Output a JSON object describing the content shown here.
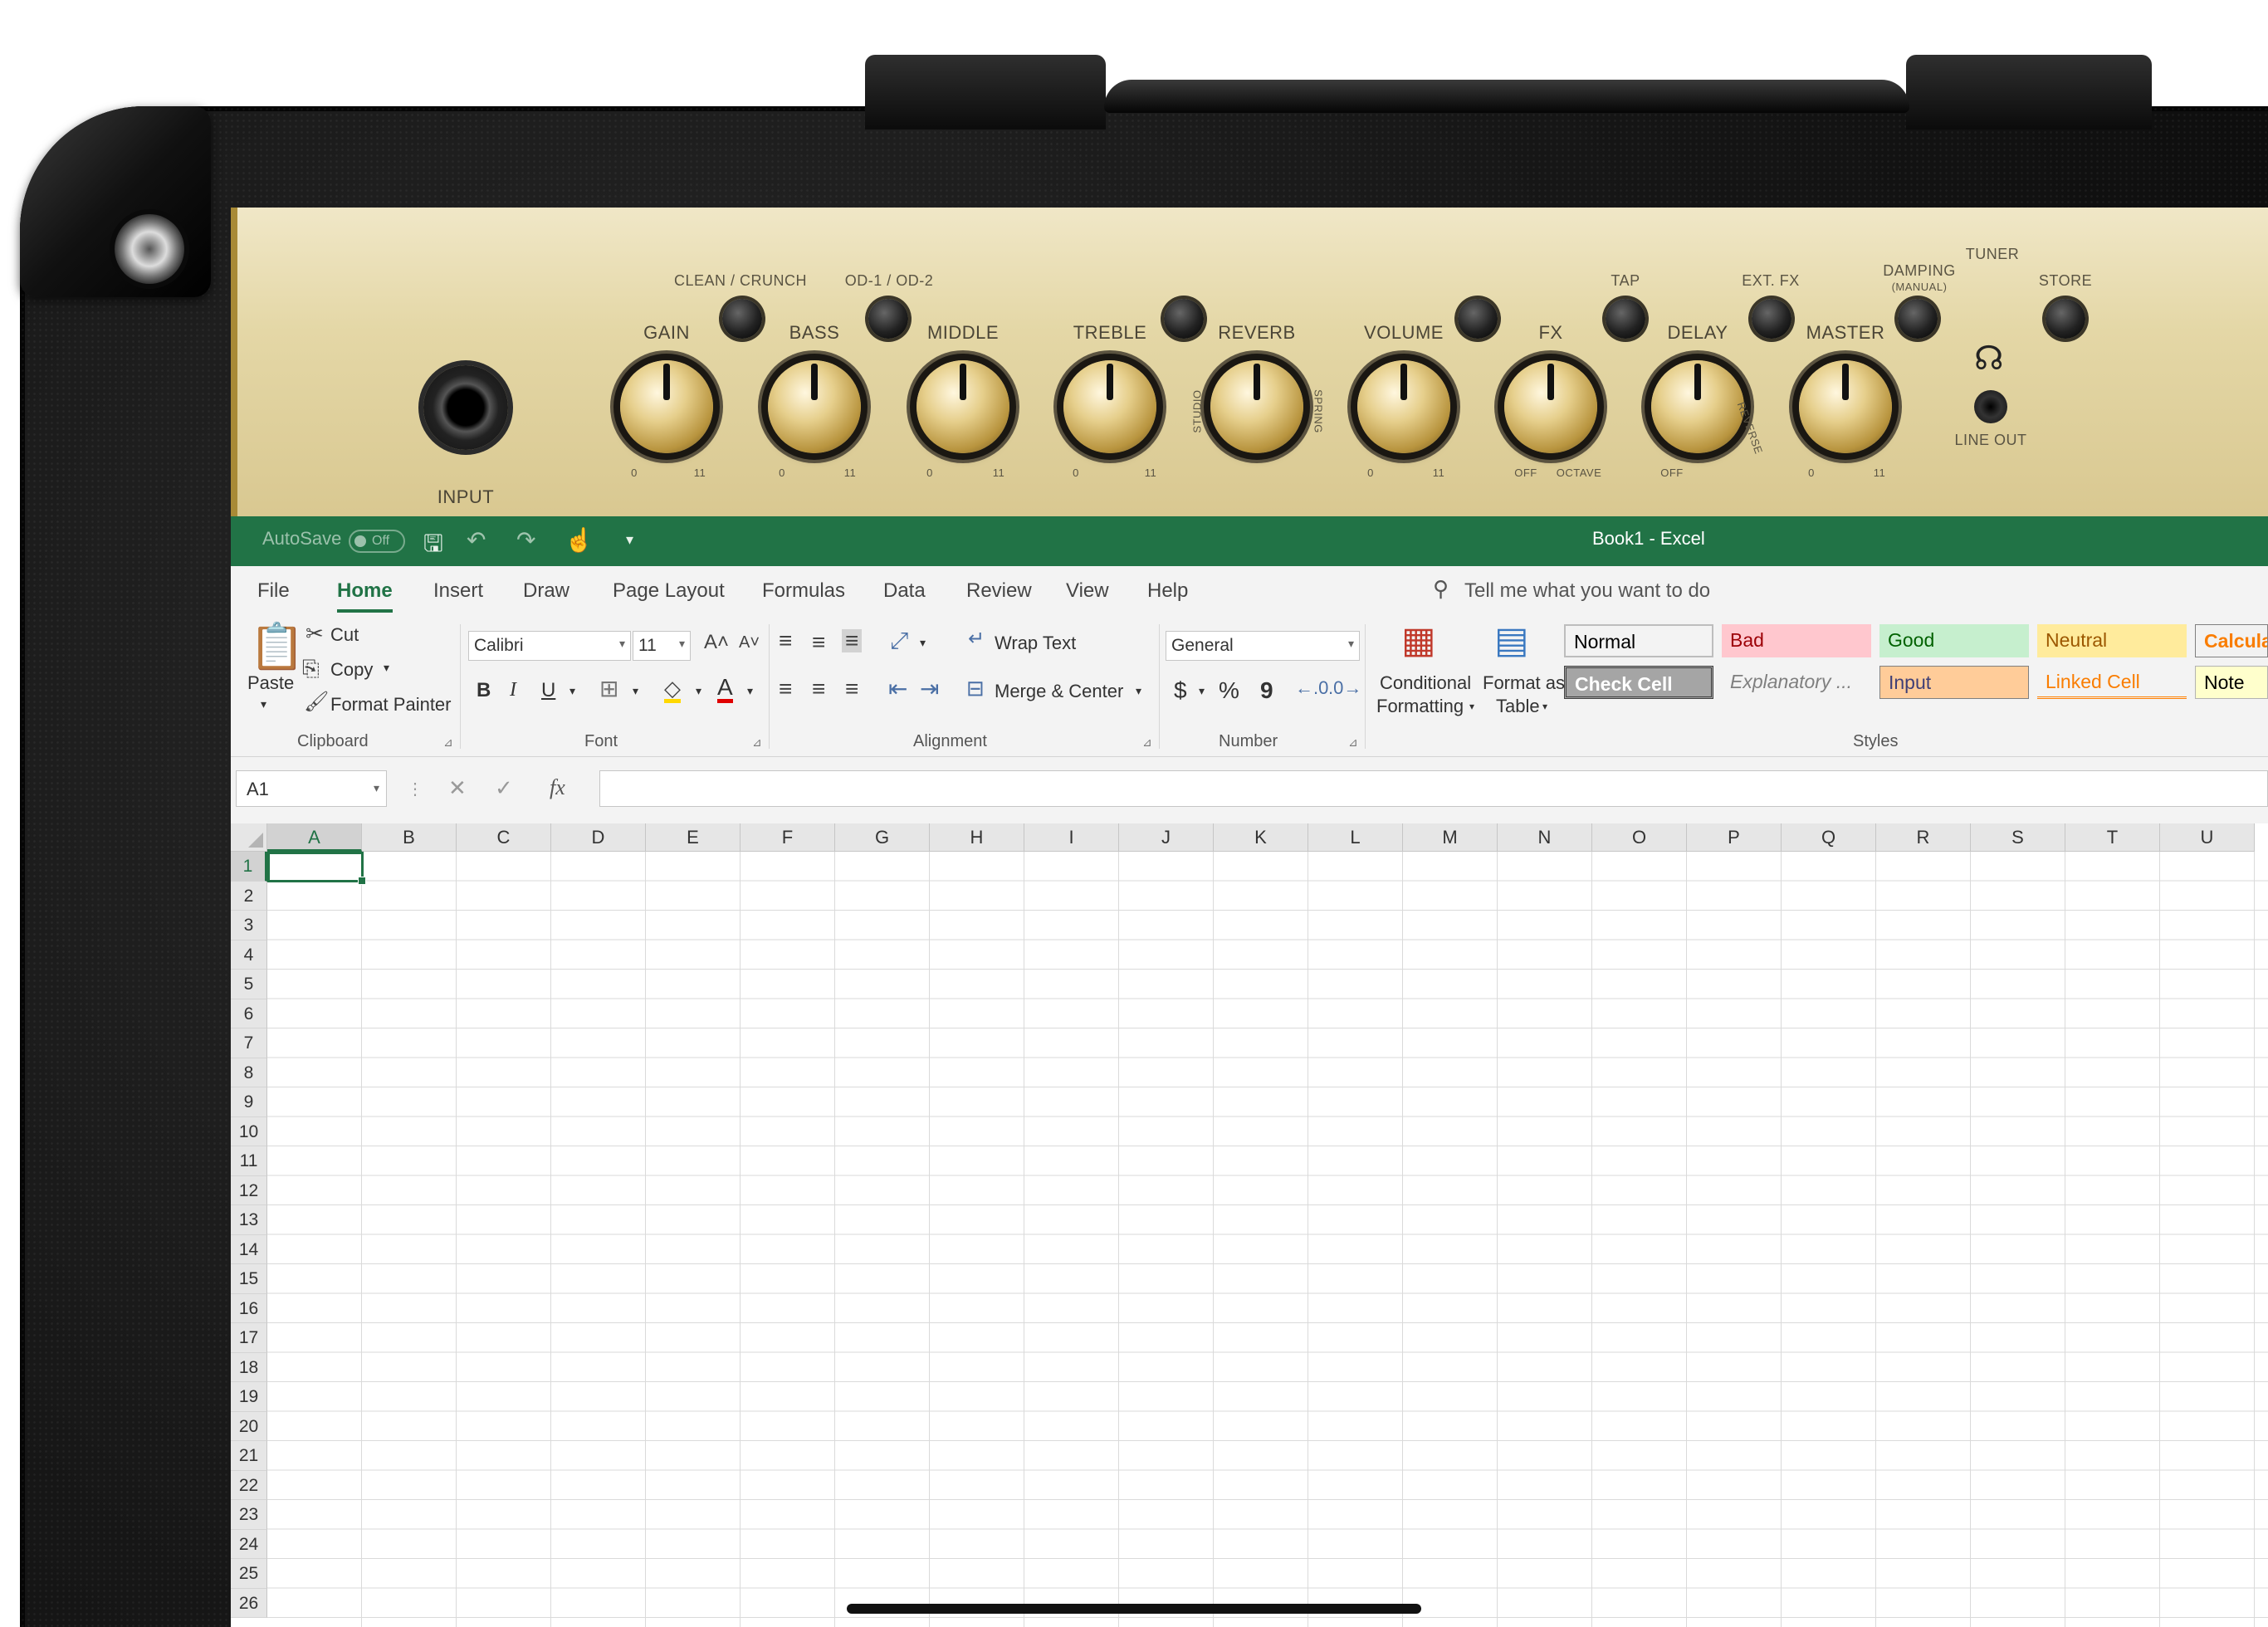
{
  "amp": {
    "input_label": "INPUT",
    "line_out_label": "LINE OUT",
    "channel_labels": {
      "clean_crunch": "CLEAN / CRUNCH",
      "od": "OD-1 / OD-2",
      "tap": "TAP",
      "ext_fx": "EXT. FX",
      "tuner": "TUNER",
      "damping": "DAMPING",
      "damping_sub": "(MANUAL)",
      "store": "STORE"
    },
    "knobs": [
      {
        "label": "GAIN",
        "min": "0",
        "max": "11"
      },
      {
        "label": "BASS",
        "min": "0",
        "max": "11"
      },
      {
        "label": "MIDDLE",
        "min": "0",
        "max": "11"
      },
      {
        "label": "TREBLE",
        "min": "0",
        "max": "11"
      },
      {
        "label": "REVERB",
        "min": "STUDIO",
        "max": "SPRING"
      },
      {
        "label": "VOLUME",
        "min": "0",
        "max": "11"
      },
      {
        "label": "FX",
        "min": "OFF",
        "max": "OCTAVE"
      },
      {
        "label": "DELAY",
        "min": "OFF",
        "max": "REVERSE"
      },
      {
        "label": "MASTER",
        "min": "0",
        "max": "11"
      }
    ]
  },
  "titlebar": {
    "autosave_label": "AutoSave",
    "autosave_state": "Off",
    "doc_title": "Book1  -  Excel",
    "accent": "#217346"
  },
  "ribbon_tabs": [
    "File",
    "Home",
    "Insert",
    "Draw",
    "Page Layout",
    "Formulas",
    "Data",
    "Review",
    "View",
    "Help"
  ],
  "tell_me": "Tell me what you want to do",
  "clipboard": {
    "paste": "Paste",
    "cut": "Cut",
    "copy": "Copy",
    "format_painter": "Format Painter",
    "group": "Clipboard"
  },
  "font": {
    "name": "Calibri",
    "size": "11",
    "bold": "B",
    "italic": "I",
    "underline": "U",
    "group": "Font"
  },
  "alignment": {
    "wrap_text": "Wrap Text",
    "merge_center": "Merge & Center",
    "group": "Alignment"
  },
  "number": {
    "format": "General",
    "currency": "$",
    "percent": "%",
    "comma": "9",
    "group": "Number"
  },
  "styles": {
    "conditional_formatting_1": "Conditional",
    "conditional_formatting_2": "Formatting",
    "format_as_table_1": "Format as",
    "format_as_table_2": "Table",
    "group": "Styles",
    "cells": [
      {
        "label": "Normal",
        "color": "#000000",
        "bg": "#ffffff"
      },
      {
        "label": "Bad",
        "color": "#9c0006",
        "bg": "#ffc7ce"
      },
      {
        "label": "Good",
        "color": "#006100",
        "bg": "#c6efce"
      },
      {
        "label": "Neutral",
        "color": "#9c5700",
        "bg": "#ffeb9c"
      },
      {
        "label": "Calcula",
        "color": "#fa7d00",
        "bg": "#f2f2f2"
      },
      {
        "label": "Check Cell",
        "color": "#ffffff",
        "bg": "#a5a5a5"
      },
      {
        "label": "Explanatory ...",
        "color": "#7f7f7f",
        "bg": "#f3f3f3"
      },
      {
        "label": "Input",
        "color": "#3f3f76",
        "bg": "#ffcc99"
      },
      {
        "label": "Linked Cell",
        "color": "#fa7d00",
        "bg": "#f3f3f3"
      },
      {
        "label": "Note",
        "color": "#000000",
        "bg": "#ffffcc"
      }
    ]
  },
  "formula_bar": {
    "name_box": "A1",
    "fx": "fx",
    "value": ""
  },
  "grid": {
    "columns": [
      "A",
      "B",
      "C",
      "D",
      "E",
      "F",
      "G",
      "H",
      "I",
      "J",
      "K",
      "L",
      "M",
      "N",
      "O",
      "P",
      "Q",
      "R",
      "S",
      "T",
      "U"
    ],
    "rows": [
      "1",
      "2",
      "3",
      "4",
      "5",
      "6",
      "7",
      "8",
      "9",
      "10",
      "11",
      "12",
      "13",
      "14",
      "15",
      "16",
      "17",
      "18",
      "19",
      "20",
      "21",
      "22",
      "23",
      "24",
      "25",
      "26"
    ],
    "active_cell": "A1"
  }
}
